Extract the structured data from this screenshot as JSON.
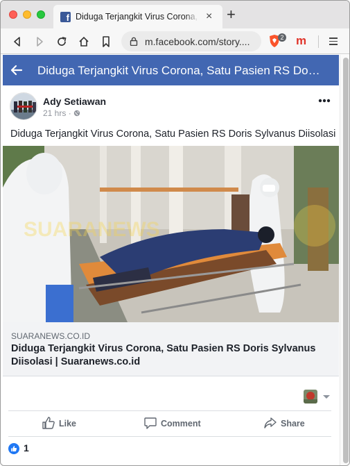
{
  "browser": {
    "tab_title": "Diduga Terjangkit Virus Corona, Satu Pasien RS Doris Sylvanus Diisolasi",
    "tab_favicon": "facebook-icon",
    "url": "m.facebook.com/story....",
    "brave_badge": "2"
  },
  "header": {
    "title": "Diduga Terjangkit Virus Corona, Satu Pasien RS Do…",
    "color": "#4267b2"
  },
  "post": {
    "author": "Ady Setiawan",
    "time": "21 hrs",
    "privacy_separator": "·",
    "text": "Diduga Terjangkit Virus Corona, Satu Pasien RS Doris Sylvanus Diisolasi"
  },
  "link": {
    "domain": "SUARANEWS.CO.ID",
    "title": "Diduga Terjangkit Virus Corona, Satu Pasien RS Doris Sylvanus Diisolasi | Suaranews.co.id"
  },
  "actions": {
    "like": "Like",
    "comment": "Comment",
    "share": "Share"
  },
  "reactions": {
    "count": "1",
    "type": "like-icon"
  }
}
